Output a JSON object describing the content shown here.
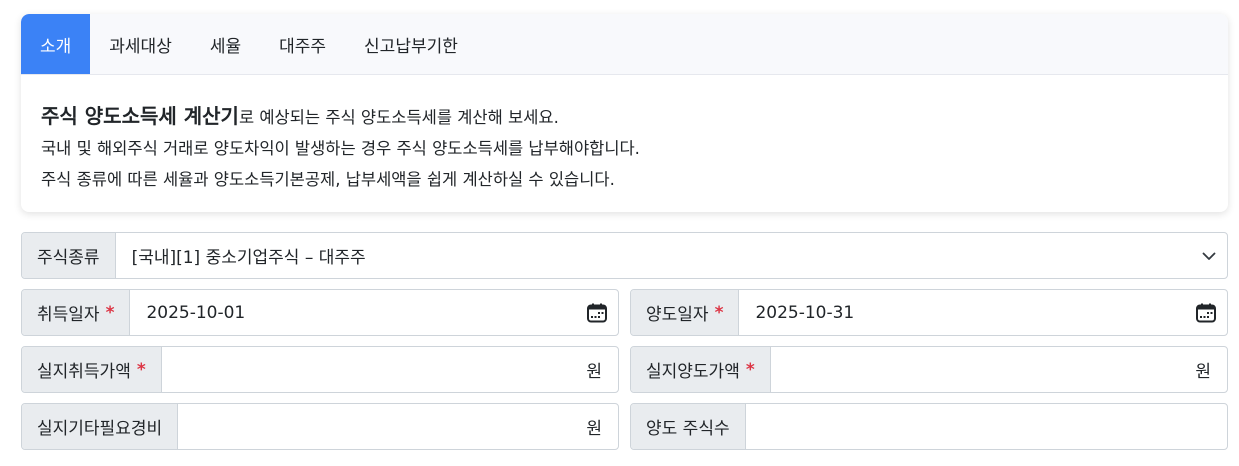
{
  "tabs": [
    {
      "label": "소개",
      "active": true
    },
    {
      "label": "과세대상",
      "active": false
    },
    {
      "label": "세율",
      "active": false
    },
    {
      "label": "대주주",
      "active": false
    },
    {
      "label": "신고납부기한",
      "active": false
    }
  ],
  "intro": {
    "title": "주식 양도소득세 계산기",
    "title_suffix": "로 예상되는 주식 양도소득세를 계산해 보세요.",
    "line2": "국내 및 해외주식 거래로 양도차익이 발생하는 경우 주식 양도소득세를 납부해야합니다.",
    "line3": "주식 종류에 따른 세율과 양도소득기본공제, 납부세액을 쉽게 계산하실 수 있습니다."
  },
  "form": {
    "stock_type": {
      "label": "주식종류",
      "value": "[국내][1] 중소기업주식 – 대주주"
    },
    "acquisition_date": {
      "label": "취득일자",
      "required_mark": "*",
      "value": "2025-10-01"
    },
    "transfer_date": {
      "label": "양도일자",
      "required_mark": "*",
      "value": "2025-10-31"
    },
    "actual_acquisition_price": {
      "label": "실지취득가액",
      "required_mark": "*",
      "value": "",
      "unit": "원"
    },
    "actual_transfer_price": {
      "label": "실지양도가액",
      "required_mark": "*",
      "value": "",
      "unit": "원"
    },
    "other_expenses": {
      "label": "실지기타필요경비",
      "value": "",
      "unit": "원"
    },
    "shares_transferred": {
      "label": "양도 주식수",
      "value": ""
    }
  },
  "colors": {
    "accent": "#3b82f6",
    "required": "#dc3545",
    "label_bg": "#e9ecef"
  },
  "icons": {
    "calendar": "calendar-icon",
    "dropdown": "chevron-down-icon"
  }
}
